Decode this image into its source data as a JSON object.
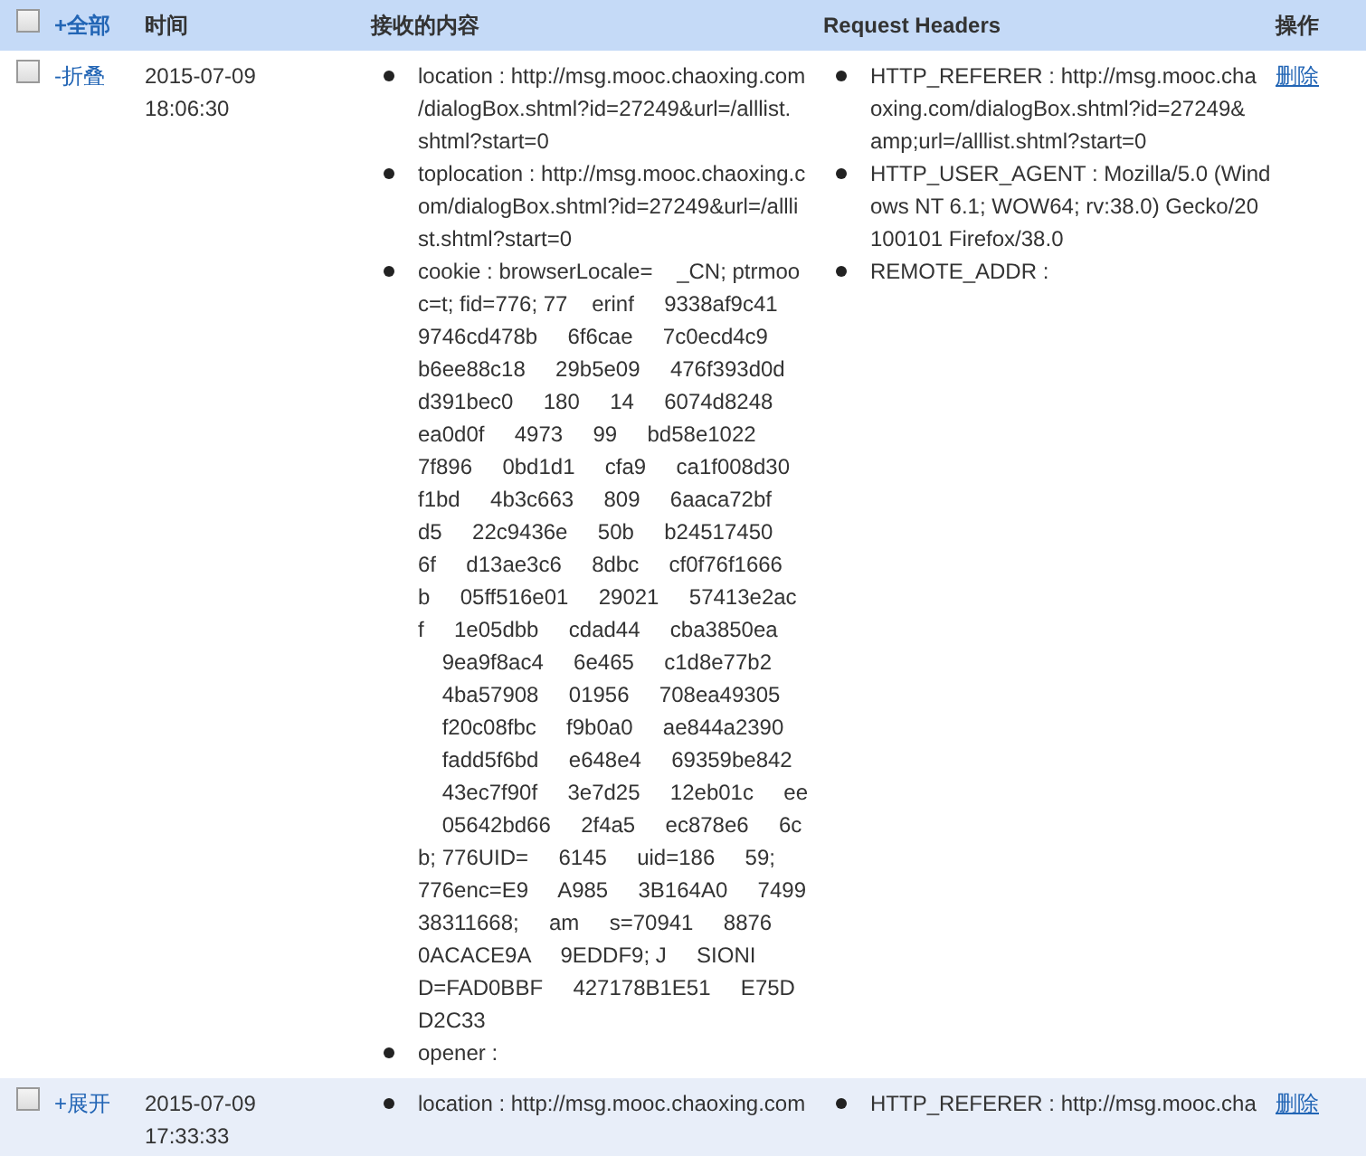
{
  "table": {
    "header": {
      "select_all_checked": false,
      "toggle_all": "+全部",
      "columns": [
        "时间",
        "接收的内容",
        "Request Headers",
        "操作"
      ]
    },
    "rows": [
      {
        "checked": false,
        "expanded": true,
        "toggle": "-折叠",
        "date": "2015-07-09",
        "time": "18:06:30",
        "content": [
          {
            "lines": [
              "location : http://msg.mooc.chaoxing.com",
              "/dialogBox.shtml?id=27249&url=/alllist.",
              "shtml?start=0"
            ]
          },
          {
            "lines": [
              "toplocation : http://msg.mooc.chaoxing.c",
              "om/dialogBox.shtml?id=27249&url=/allli",
              "st.shtml?start=0"
            ]
          },
          {
            "lines": [
              "cookie : browserLocale=    _CN; ptrmoo",
              "c=t; fid=776; 77    erinf     9338af9c41",
              "9746cd478b     6f6cae     7c0ecd4c9",
              "b6ee88c18     29b5e09     476f393d0d",
              "d391bec0     180     14     6074d8248",
              "ea0d0f     4973     99     bd58e1022",
              "7f896     0bd1d1     cfa9     ca1f008d30",
              "f1bd     4b3c663     809     6aaca72bf",
              "d5     22c9436e     50b     b24517450",
              "6f     d13ae3c6     8dbc     cf0f76f1666",
              "b     05ff516e01     29021     57413e2ac",
              "f     1e05dbb     cdad44     cba3850ea",
              "    9ea9f8ac4     6e465     c1d8e77b2",
              "    4ba57908     01956     708ea49305",
              "    f20c08fbc     f9b0a0     ae844a2390",
              "    fadd5f6bd     e648e4     69359be842",
              "    43ec7f90f     3e7d25     12eb01c     ee",
              "    05642bd66     2f4a5     ec878e6     6c",
              "b; 776UID=     6145     uid=186     59;",
              "776enc=E9     A985     3B164A0     7499",
              "38311668;     am     s=70941     8876",
              "0ACACE9A     9EDDF9; J     SIONI",
              "D=FAD0BBF     427178B1E51     E75D",
              "D2C33"
            ]
          },
          {
            "lines": [
              "opener :"
            ]
          }
        ],
        "headers": [
          {
            "lines": [
              "HTTP_REFERER : http://msg.mooc.cha",
              "oxing.com/dialogBox.shtml?id=27249&",
              "amp;url=/alllist.shtml?start=0"
            ]
          },
          {
            "lines": [
              "HTTP_USER_AGENT : Mozilla/5.0 (Wind",
              "ows NT 6.1; WOW64; rv:38.0) Gecko/20",
              "100101 Firefox/38.0"
            ]
          },
          {
            "lines": [
              "REMOTE_ADDR :"
            ]
          }
        ],
        "action": "删除"
      },
      {
        "checked": false,
        "expanded": false,
        "toggle": "+展开",
        "date": "2015-07-09",
        "time": "17:33:33",
        "content": [
          {
            "lines": [
              "location : http://msg.mooc.chaoxing.com"
            ]
          }
        ],
        "headers": [
          {
            "lines": [
              "HTTP_REFERER : http://msg.mooc.cha"
            ]
          }
        ],
        "action": "删除"
      }
    ]
  }
}
